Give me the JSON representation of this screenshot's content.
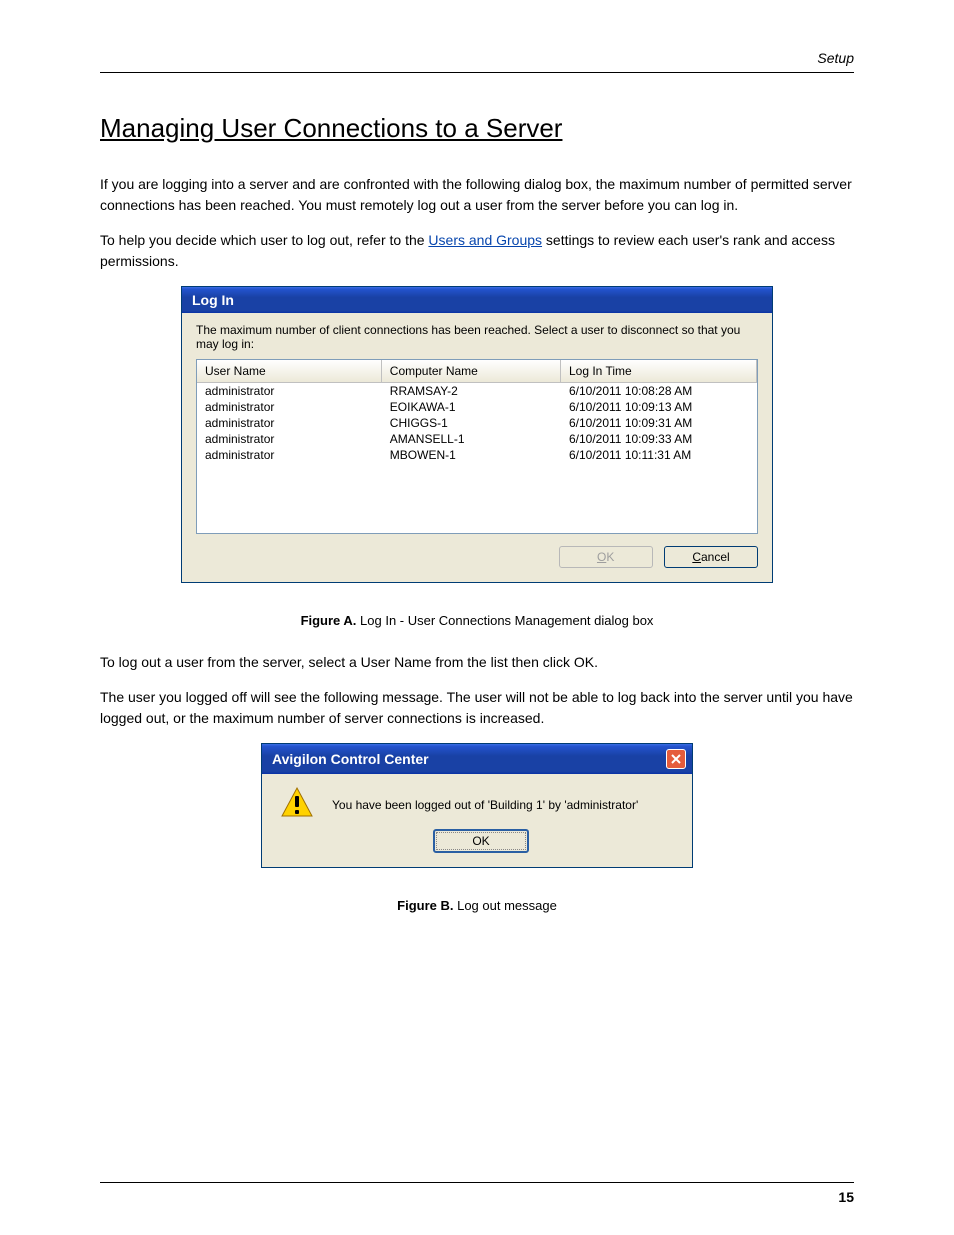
{
  "header": {
    "section": "Setup"
  },
  "title": "Managing User Connections to a Server",
  "p1": "If you are logging into a server and are confronted with the following dialog box, the maximum number of permitted server connections has been reached. You must remotely log out a user from the server before you can log in.",
  "p2a": "To help you decide which user to log out, refer to the ",
  "p2_link": "Users and Groups",
  "p2b": " settings to review each user's rank and access permissions.",
  "dialog1": {
    "title": "Log In",
    "message": "The maximum number of client connections has been reached. Select a user to disconnect so that you may log in:",
    "cols": {
      "c1": "User Name",
      "c2": "Computer Name",
      "c3": "Log In Time"
    },
    "rows": [
      {
        "user": "administrator",
        "comp": "RRAMSAY-2",
        "time": "6/10/2011 10:08:28 AM"
      },
      {
        "user": "administrator",
        "comp": "EOIKAWA-1",
        "time": "6/10/2011 10:09:13 AM"
      },
      {
        "user": "administrator",
        "comp": "CHIGGS-1",
        "time": "6/10/2011 10:09:31 AM"
      },
      {
        "user": "administrator",
        "comp": "AMANSELL-1",
        "time": "6/10/2011 10:09:33 AM"
      },
      {
        "user": "administrator",
        "comp": "MBOWEN-1",
        "time": "6/10/2011 10:11:31 AM"
      }
    ],
    "ok": "OK",
    "cancel": "Cancel"
  },
  "fig_a": "Figure A.",
  "fig_a_text": " Log In - User Connections Management dialog box",
  "p3": "To log out a user from the server, select a User Name from the list then click OK.",
  "p4": "The user you logged off will see the following message. The user will not be able to log back into the server until you have logged out, or the maximum number of server connections is increased.",
  "dialog2": {
    "title": "Avigilon Control Center",
    "message": "You have been logged out of 'Building 1' by 'administrator'",
    "ok": "OK"
  },
  "fig_b": "Figure B.",
  "fig_b_text": " Log out message",
  "footer": {
    "page": "15"
  }
}
